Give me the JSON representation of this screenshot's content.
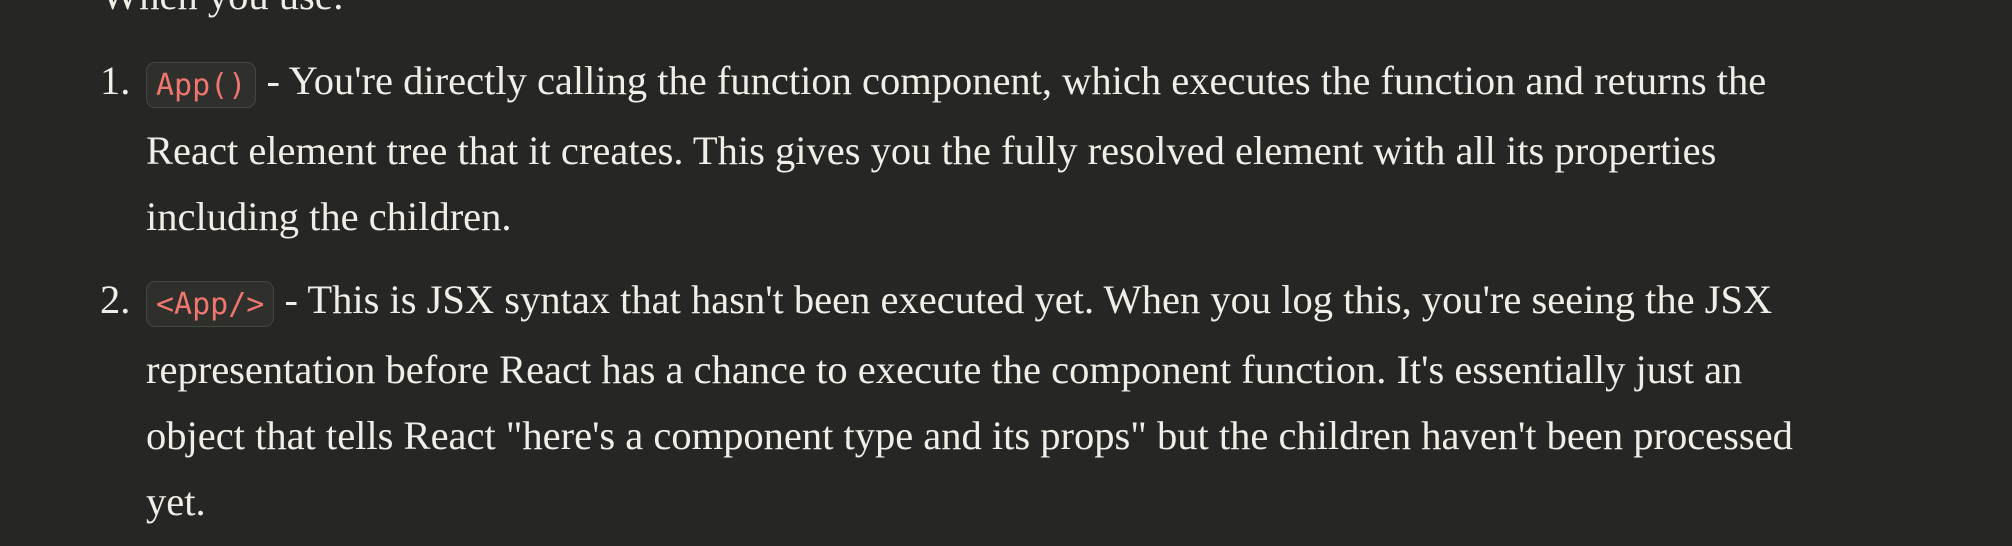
{
  "clipped_line": "When you use:",
  "items": [
    {
      "number": "1.",
      "code": "App()",
      "text": " - You're directly calling the function component, which executes the function and returns the React element tree that it creates. This gives you the fully resolved element with all its properties including the children."
    },
    {
      "number": "2.",
      "code": "<App/>",
      "text": " - This is JSX syntax that hasn't been executed yet. When you log this, you're seeing the JSX representation before React has a chance to execute the component function. It's essentially just an object that tells React \"here's a component type and its props\" but the children haven't been processed yet."
    }
  ]
}
